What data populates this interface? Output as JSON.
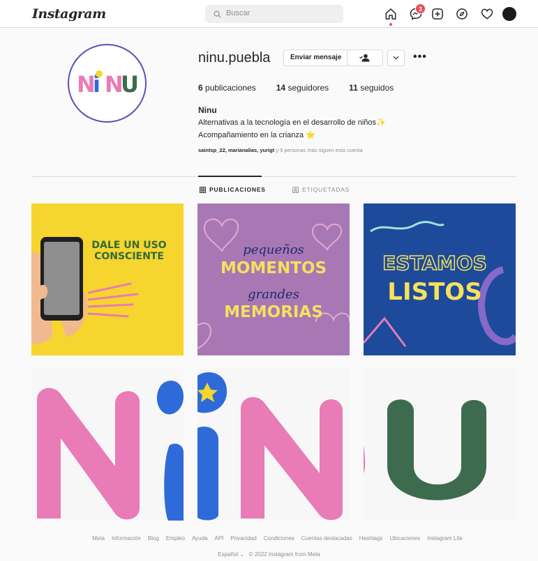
{
  "nav": {
    "logo": "Instagram",
    "search_placeholder": "Buscar",
    "notification_count": "3"
  },
  "profile": {
    "username": "ninu.puebla",
    "message_button": "Enviar mensaje",
    "stats": {
      "posts_count": "6",
      "posts_label": "publicaciones",
      "followers_count": "14",
      "followers_label": "seguidores",
      "following_count": "11",
      "following_label": "seguidos"
    },
    "bio_name": "Ninu",
    "bio_line1": "Alternativas a la tecnología en el desarrollo de niños✨",
    "bio_line2": "Acompañamiento en la crianza ⭐",
    "followed_by_names": "saintsp_22, marianalias, yurigt",
    "followed_by_rest": "y 9 personas más siguen esta cuenta",
    "avatar_text": "NiNU"
  },
  "tabs": [
    {
      "label": "PUBLICACIONES",
      "active": true
    },
    {
      "label": "ETIQUETADAS",
      "active": false
    }
  ],
  "posts": [
    {
      "line1": "DALE UN USO",
      "line2": "CONSCIENTE"
    },
    {
      "script1": "pequeños",
      "bold1": "MOMENTOS",
      "script2": "grandes",
      "bold2": "MEMORIAS"
    },
    {
      "line1": "ESTAMOS",
      "line2": "LISTOS"
    },
    {
      "letter": "N"
    },
    {
      "letter": "iN"
    },
    {
      "letter": "U"
    }
  ],
  "footer": {
    "links": [
      "Meta",
      "Información",
      "Blog",
      "Empleo",
      "Ayuda",
      "API",
      "Privacidad",
      "Condiciones",
      "Cuentas destacadas",
      "Hashtags",
      "Ubicaciones",
      "Instagram Lite"
    ],
    "language": "Español",
    "copyright": "© 2022 Instagram from Meta"
  },
  "colors": {
    "accent_red": "#ed4956",
    "brand_pink": "#e97bb6",
    "brand_blue": "#2f6bd8",
    "brand_green": "#3d6b4e",
    "brand_yellow": "#f6d52e",
    "brand_purple": "#a878b5",
    "brand_navy": "#1d4a9b"
  }
}
